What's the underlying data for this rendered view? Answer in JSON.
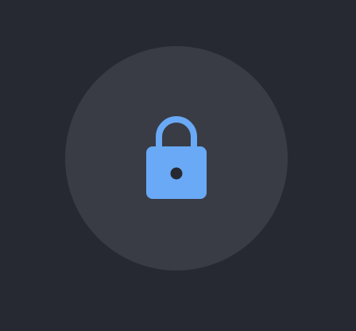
{
  "lock_badge": {
    "icon": "lock-icon",
    "icon_color": "#6aa9f6",
    "badge_color": "#393c45",
    "background_color": "#262932"
  }
}
